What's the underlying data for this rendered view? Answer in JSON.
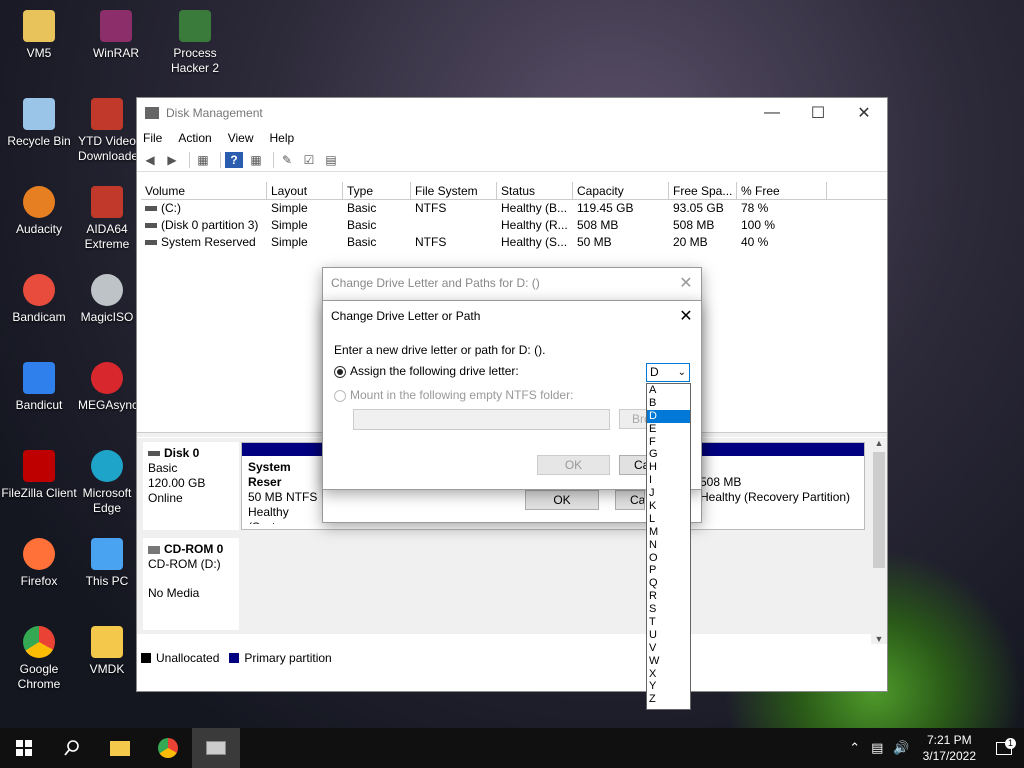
{
  "desktop": {
    "icons": [
      {
        "label": "VM5",
        "color": "#e8c25a"
      },
      {
        "label": "WinRAR",
        "color": "#8b2e6a"
      },
      {
        "label": "Process Hacker 2",
        "color": "#3a7a3a"
      },
      {
        "label": "Recycle Bin",
        "color": "#9ac4e8"
      },
      {
        "label": "YTD Video Downloader",
        "color": "#c0392b"
      },
      {
        "label": "Audacity",
        "color": "#e67e22"
      },
      {
        "label": "AIDA64 Extreme",
        "color": "#c0392b"
      },
      {
        "label": "Bandicam",
        "color": "#e74c3c"
      },
      {
        "label": "MagicISO",
        "color": "#bdc3c7"
      },
      {
        "label": "Bandicut",
        "color": "#2f80ed"
      },
      {
        "label": "MEGAsync",
        "color": "#d9272e"
      },
      {
        "label": "FileZilla Client",
        "color": "#bf0000"
      },
      {
        "label": "Microsoft Edge",
        "color": "#1fa4c9"
      },
      {
        "label": "Firefox",
        "color": "#ff7139"
      },
      {
        "label": "This PC",
        "color": "#4aa3f0"
      },
      {
        "label": "Google Chrome",
        "color": "#34a853"
      },
      {
        "label": "VMDK",
        "color": "#f3c84b"
      }
    ]
  },
  "window": {
    "title": "Disk Management",
    "menu": [
      "File",
      "Action",
      "View",
      "Help"
    ],
    "columns": [
      "Volume",
      "Layout",
      "Type",
      "File System",
      "Status",
      "Capacity",
      "Free Spa...",
      "% Free"
    ],
    "rows": [
      [
        "(C:)",
        "Simple",
        "Basic",
        "NTFS",
        "Healthy (B...",
        "119.45 GB",
        "93.05 GB",
        "78 %"
      ],
      [
        "(Disk 0 partition 3)",
        "Simple",
        "Basic",
        "",
        "Healthy (R...",
        "508 MB",
        "508 MB",
        "100 %"
      ],
      [
        "System Reserved",
        "Simple",
        "Basic",
        "NTFS",
        "Healthy (S...",
        "50 MB",
        "20 MB",
        "40 %"
      ]
    ],
    "disk0": {
      "name": "Disk 0",
      "type": "Basic",
      "size": "120.00 GB",
      "state": "Online",
      "partition1_name": "System Reser",
      "partition1_size": "50 MB NTFS",
      "partition1_status": "Healthy (Syste",
      "partition3_size": "508 MB",
      "partition3_status": "Healthy (Recovery Partition)"
    },
    "cdrom0": {
      "name": "CD-ROM 0",
      "type": "CD-ROM (D:)",
      "media": "No Media"
    },
    "legend": {
      "unallocated": "Unallocated",
      "primary": "Primary partition"
    }
  },
  "dialog_back": {
    "title": "Change Drive Letter and Paths for D: ()",
    "ok": "OK",
    "cancel": "Ca"
  },
  "dialog": {
    "title": "Change Drive Letter or Path",
    "prompt": "Enter a new drive letter or path for D: ().",
    "assign_label": "Assign the following drive letter:",
    "mount_label": "Mount in the following empty NTFS folder:",
    "browse": "Bro",
    "ok": "OK",
    "cancel": "Ca",
    "selected_letter": "D"
  },
  "dropdown_letters": [
    "A",
    "B",
    "D",
    "E",
    "F",
    "G",
    "H",
    "I",
    "J",
    "K",
    "L",
    "M",
    "N",
    "O",
    "P",
    "Q",
    "R",
    "S",
    "T",
    "U",
    "V",
    "W",
    "X",
    "Y",
    "Z"
  ],
  "taskbar": {
    "time": "7:21 PM",
    "date": "3/17/2022",
    "notification_count": "1"
  }
}
